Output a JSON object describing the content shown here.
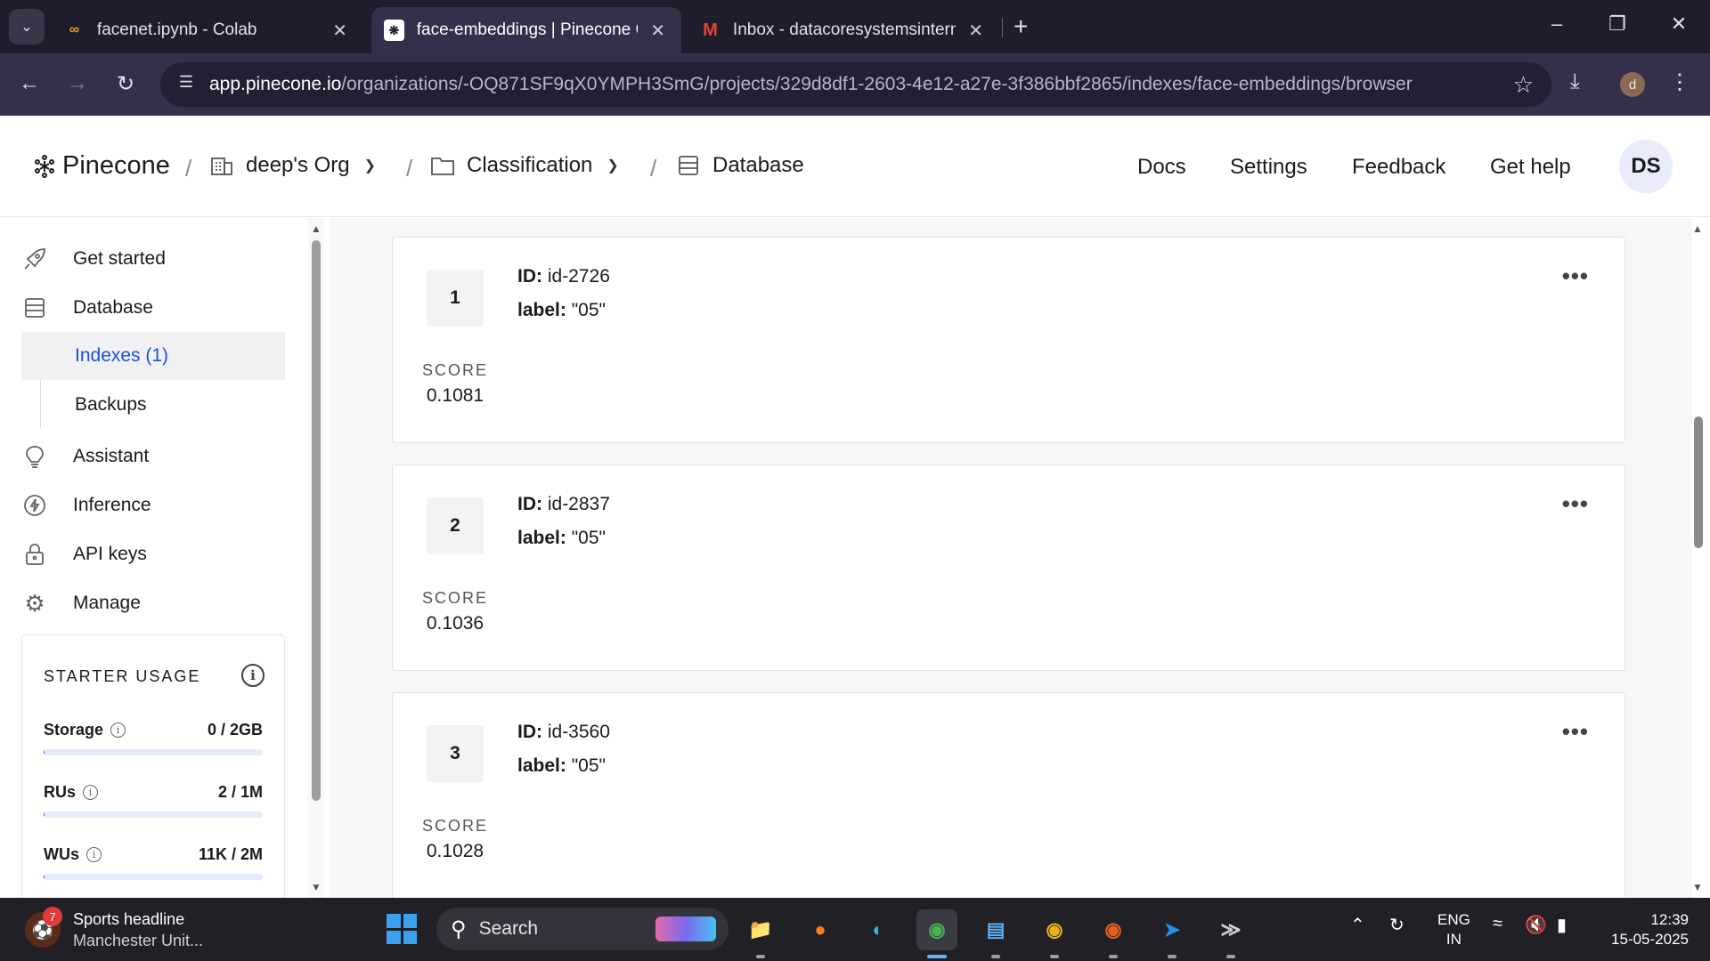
{
  "browser": {
    "tabs": [
      {
        "title": "facenet.ipynb - Colab",
        "icon": "colab-icon",
        "active": false
      },
      {
        "title": "face-embeddings | Pinecone Co",
        "icon": "pinecone-icon",
        "active": true
      },
      {
        "title": "Inbox - datacoresystemsintern@",
        "icon": "gmail-icon",
        "active": false
      }
    ],
    "url_host": "app.pinecone.io",
    "url_path": "/organizations/-OQ871SF9qX0YMPH3SmG/projects/329d8df1-2603-4e12-a27e-3f386bbf2865/indexes/face-embeddings/browser",
    "profile_initial": "d"
  },
  "header": {
    "logo_text": "Pinecone",
    "breadcrumbs": [
      {
        "label": "deep's Org",
        "icon": "org-icon",
        "dropdown": true
      },
      {
        "label": "Classification",
        "icon": "folder-icon",
        "dropdown": true
      },
      {
        "label": "Database",
        "icon": "database-icon",
        "dropdown": false
      }
    ],
    "links": [
      "Docs",
      "Settings",
      "Feedback",
      "Get help"
    ],
    "avatar_initials": "DS"
  },
  "sidebar": {
    "items": [
      {
        "label": "Get started",
        "icon": "rocket-icon"
      },
      {
        "label": "Database",
        "icon": "database-icon"
      },
      {
        "label": "Assistant",
        "icon": "lightbulb-icon"
      },
      {
        "label": "Inference",
        "icon": "bolt-icon"
      },
      {
        "label": "API keys",
        "icon": "lock-icon"
      },
      {
        "label": "Manage",
        "icon": "gear-icon"
      }
    ],
    "subitems": [
      {
        "label": "Indexes (1)",
        "active": true
      },
      {
        "label": "Backups",
        "active": false
      }
    ],
    "usage": {
      "title": "STARTER USAGE",
      "rows": [
        {
          "label": "Storage",
          "value": "0 / 2GB",
          "fraction": 0.0
        },
        {
          "label": "RUs",
          "value": "2 / 1M",
          "fraction": 0.0
        },
        {
          "label": "WUs",
          "value": "11K / 2M",
          "fraction": 0.0055
        }
      ]
    }
  },
  "results": [
    {
      "rank": "1",
      "id": "id-2726",
      "label": "\"05\"",
      "score": "0.1081"
    },
    {
      "rank": "2",
      "id": "id-2837",
      "label": "\"05\"",
      "score": "0.1036"
    },
    {
      "rank": "3",
      "id": "id-3560",
      "label": "\"05\"",
      "score": "0.1028"
    }
  ],
  "result_labels": {
    "id_key": "ID:",
    "label_key": "label:",
    "score_key": "SCORE"
  },
  "taskbar": {
    "news_badge": "7",
    "news_title": "Sports headline",
    "news_subtitle": "Manchester Unit...",
    "search_placeholder": "Search",
    "lang_line1": "ENG",
    "lang_line2": "IN",
    "time": "12:39",
    "date": "15-05-2025"
  },
  "colors": {
    "accent_blue": "#1d4ed8",
    "usage_fill": "#2f5bd9",
    "chrome_dark": "#1f1c2c"
  }
}
